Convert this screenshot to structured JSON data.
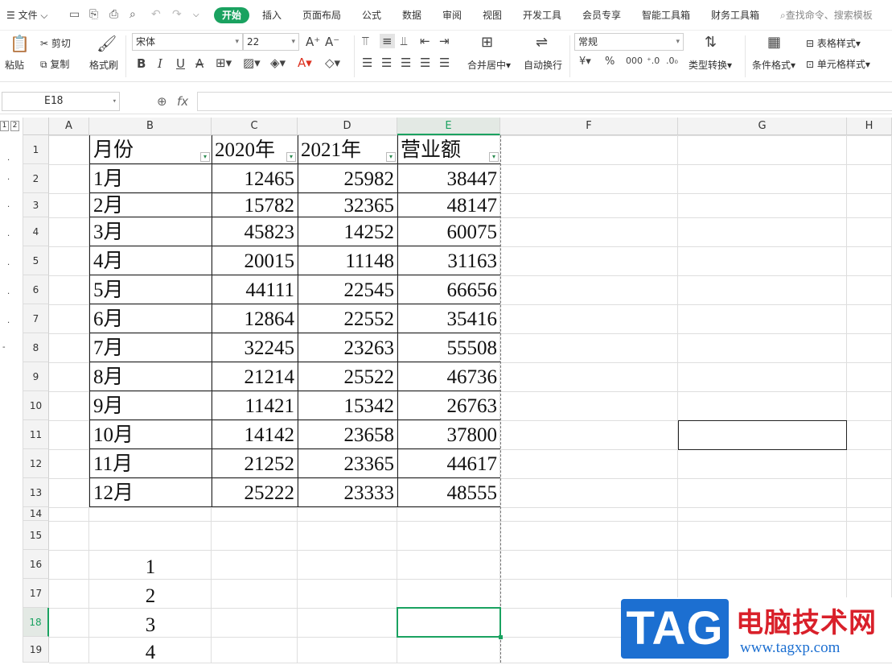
{
  "menubar": {
    "file_label": "文件",
    "tabs": [
      "开始",
      "插入",
      "页面布局",
      "公式",
      "数据",
      "审阅",
      "视图",
      "开发工具",
      "会员专享",
      "智能工具箱",
      "财务工具箱"
    ],
    "active_tab": "开始",
    "search_placeholder": "查找命令、搜索模板"
  },
  "ribbon": {
    "paste": "粘贴",
    "cut": "剪切",
    "copy": "复制",
    "format_painter": "格式刷",
    "font_name": "宋体",
    "font_size": "22",
    "merge_center": "合并居中",
    "wrap_text": "自动换行",
    "number_format": "常规",
    "type_convert": "类型转换",
    "conditional_format": "条件格式",
    "table_style": "表格样式",
    "cell_style": "单元格样式"
  },
  "formula_bar": {
    "name_box": "E18",
    "fx": "fx",
    "content": ""
  },
  "grid": {
    "outline_levels": [
      "1",
      "2"
    ],
    "columns": [
      "A",
      "B",
      "C",
      "D",
      "E",
      "F",
      "G",
      "H"
    ],
    "active_column": "E",
    "active_row": "18",
    "rows": [
      "1",
      "2",
      "3",
      "4",
      "5",
      "6",
      "7",
      "8",
      "9",
      "10",
      "11",
      "12",
      "13",
      "14",
      "15",
      "16",
      "17",
      "18",
      "19"
    ],
    "header": [
      "月份",
      "2020年",
      "2021年",
      "营业额"
    ],
    "data": [
      [
        "1月",
        "12465",
        "25982",
        "38447"
      ],
      [
        "2月",
        "15782",
        "32365",
        "48147"
      ],
      [
        "3月",
        "45823",
        "14252",
        "60075"
      ],
      [
        "4月",
        "20015",
        "11148",
        "31163"
      ],
      [
        "5月",
        "44111",
        "22545",
        "66656"
      ],
      [
        "6月",
        "12864",
        "22552",
        "35416"
      ],
      [
        "7月",
        "32245",
        "23263",
        "55508"
      ],
      [
        "8月",
        "21214",
        "25522",
        "46736"
      ],
      [
        "9月",
        "11421",
        "15342",
        "26763"
      ],
      [
        "10月",
        "14142",
        "23658",
        "37800"
      ],
      [
        "11月",
        "21252",
        "23365",
        "44617"
      ],
      [
        "12月",
        "25222",
        "23333",
        "48555"
      ]
    ],
    "list_values": [
      "1",
      "2",
      "3",
      "4"
    ]
  },
  "watermark": {
    "logo": "TAG",
    "name": "电脑技术网",
    "url": "www.tagxp.com"
  }
}
